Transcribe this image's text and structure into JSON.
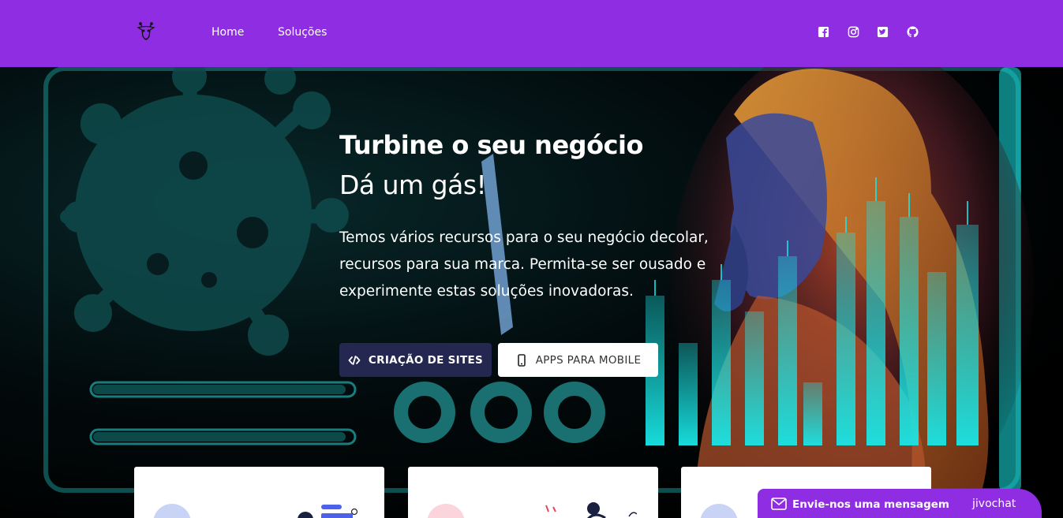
{
  "header": {
    "logo_icon": "giraffe-icon",
    "nav": [
      {
        "label": "Home"
      },
      {
        "label": "Soluções"
      }
    ],
    "social": [
      "facebook-icon",
      "instagram-icon",
      "twitter-icon",
      "github-icon"
    ],
    "bg_color": "#8e2de2"
  },
  "hero": {
    "title": "Turbine o seu negócio",
    "subtitle": "Dá um gás!",
    "text_lines": [
      "Temos vários recursos para o seu negócio decolar,",
      "recursos para sua marca. Permita-se ser ousado e",
      "experimente estas soluções inovadoras."
    ],
    "buttons": {
      "sites": {
        "label": "CRIAÇÃO DE SITES",
        "icon": "code-icon"
      },
      "apps": {
        "label": "APPS PARA MOBILE",
        "icon": "mobile-icon"
      }
    },
    "accent_color": "#19e6e6"
  },
  "chat": {
    "label": "Envie-nos uma mensagem",
    "brand": "jivochat",
    "icon": "envelope-icon"
  }
}
